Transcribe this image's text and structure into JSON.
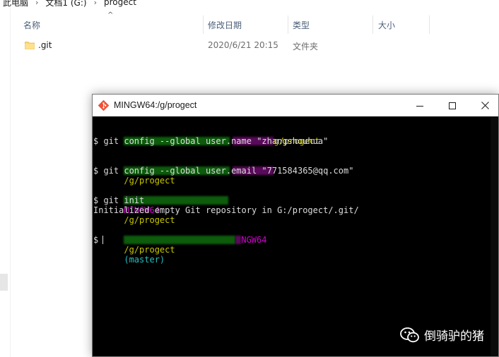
{
  "breadcrumb": [
    "此电脑",
    "文档1 (G:)",
    "progect"
  ],
  "columns": {
    "name": "名称",
    "date": "修改日期",
    "type": "类型",
    "size": "大小"
  },
  "files": [
    {
      "name": ".git",
      "date": "2020/6/21 20:15",
      "type": "文件夹",
      "size": ""
    }
  ],
  "terminal": {
    "title": "MINGW64:/g/progect",
    "lines": {
      "p1_path": "g/progect",
      "c1": "$ git config --global user.name \"zhangshouhua\"",
      "p2_path": "/g/progect",
      "c2": "$ git config --global user.email \"771584365@qq.com\"",
      "p3_env": "MINGW64",
      "p3_path": "/g/progect",
      "c3": "$ git init",
      "o3": "Initialized empty Git repository in G:/progect/.git/",
      "p4_env": "NGW64",
      "p4_path": "/g/progect",
      "p4_branch": "(master)",
      "c4": "$"
    }
  },
  "watermark": "倒骑驴的猪",
  "colors": {
    "prompt_user": "#10d10f",
    "prompt_env": "#d300d3",
    "prompt_path": "#c6c600",
    "branch": "#26bfbf"
  }
}
